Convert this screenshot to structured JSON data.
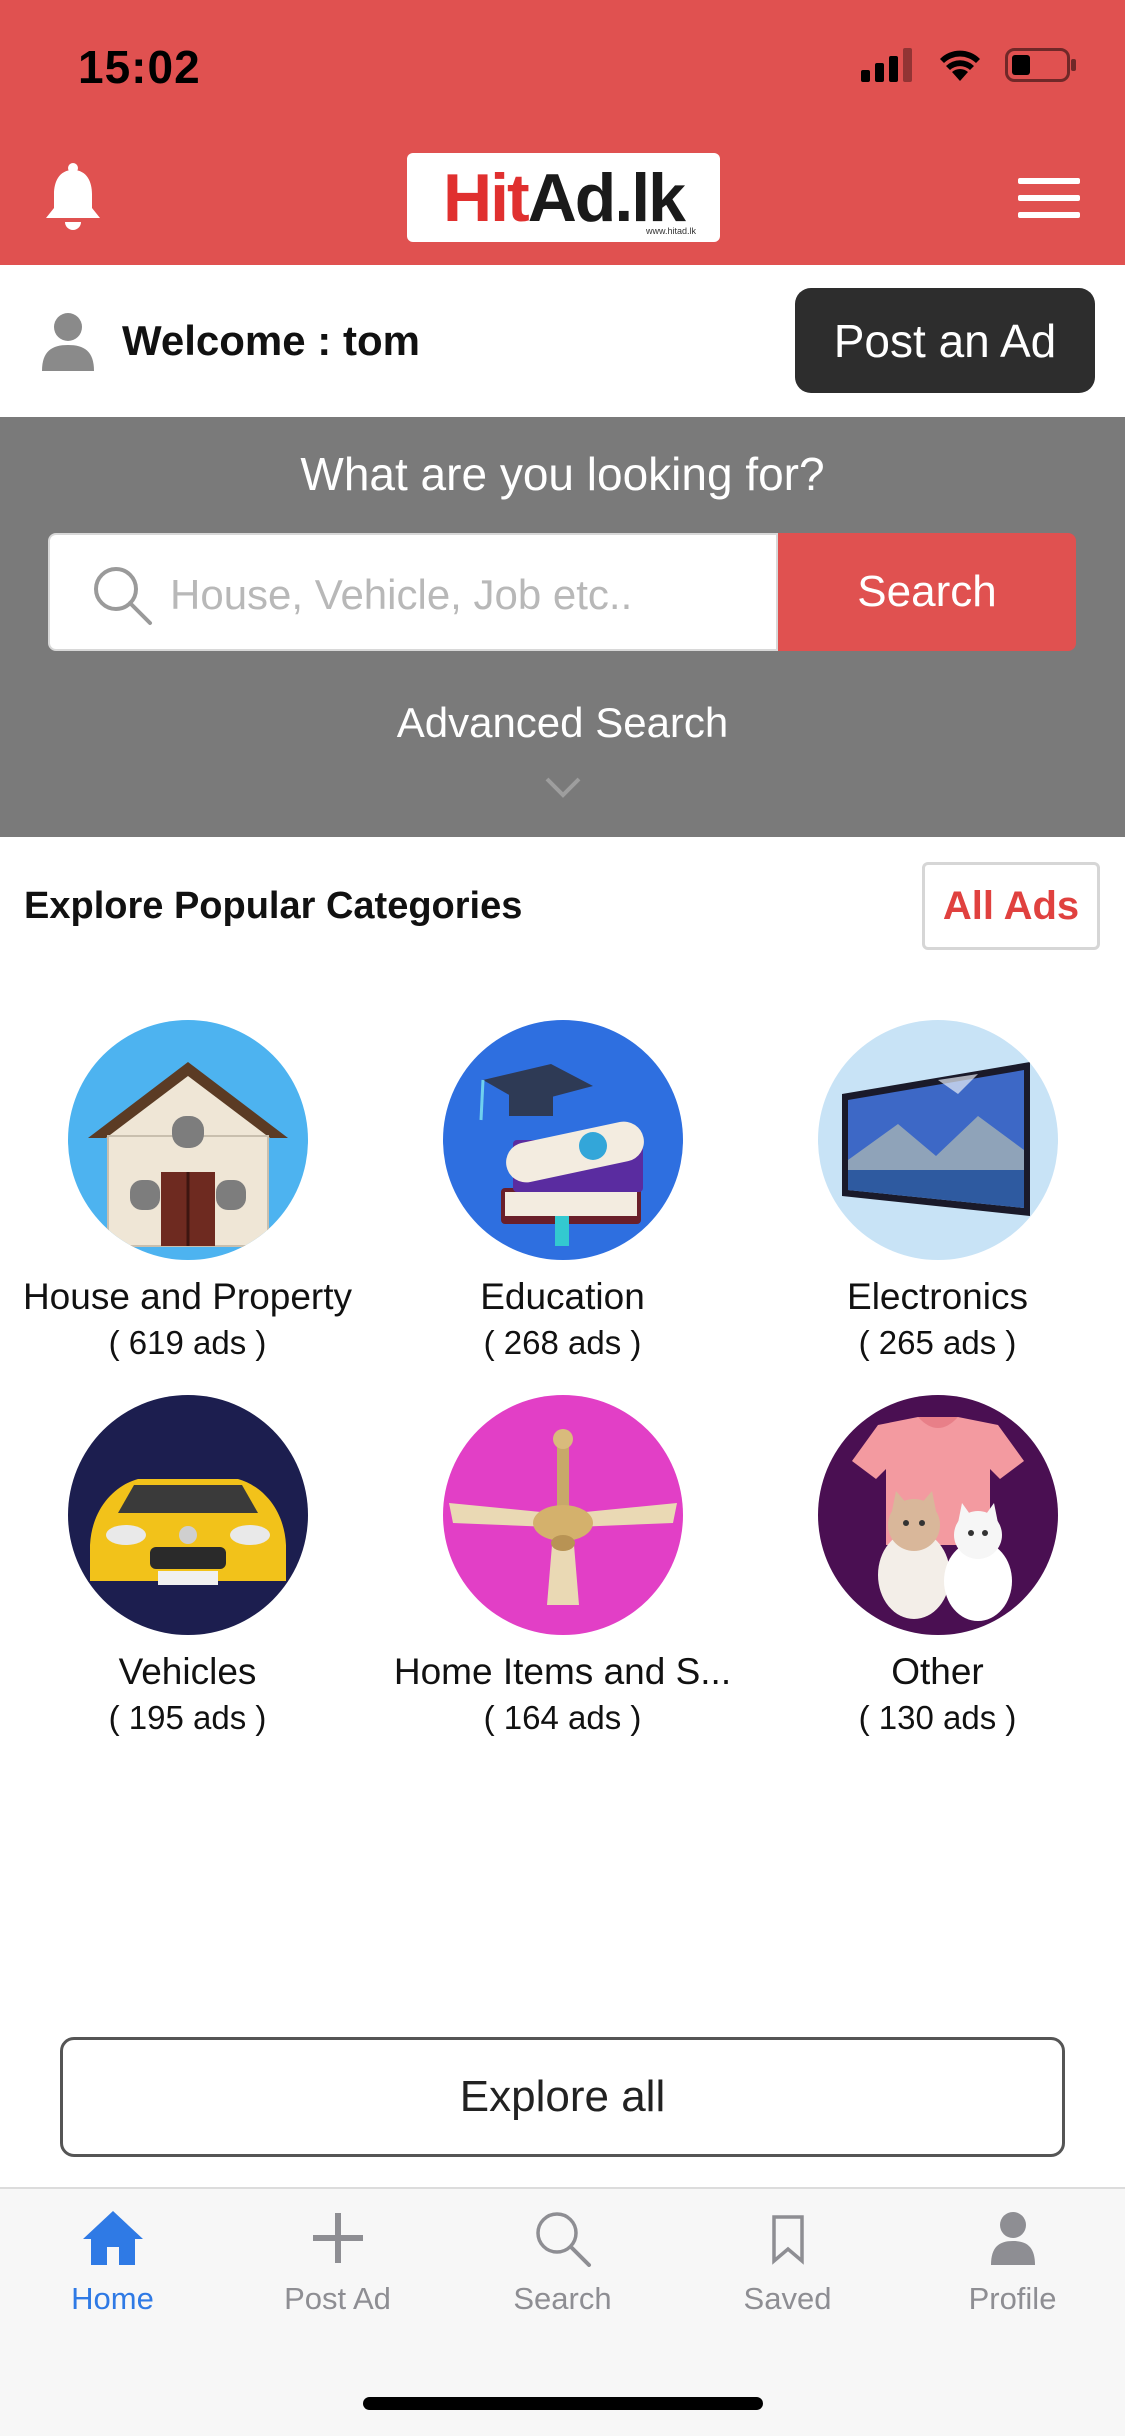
{
  "status_bar": {
    "time": "15:02",
    "icons": [
      "signal-icon",
      "wifi-icon",
      "battery-icon"
    ]
  },
  "header": {
    "logo_hit": "Hit",
    "logo_rest": "Ad.lk",
    "logo_sub": "www.hitad.lk",
    "colors": {
      "header_bg": "#e05150",
      "logo_red": "#e0302f"
    }
  },
  "welcome": {
    "text": "Welcome : tom",
    "post_ad_label": "Post an Ad"
  },
  "search": {
    "title": "What are you looking for?",
    "placeholder": "House, Vehicle, Job etc..",
    "button_label": "Search",
    "advanced_label": "Advanced Search"
  },
  "categories": {
    "heading": "Explore Popular Categories",
    "all_ads_label": "All Ads",
    "items": [
      {
        "name": "House and Property",
        "count": "( 619 ads )",
        "icon": "house-icon"
      },
      {
        "name": "Education",
        "count": "( 268 ads )",
        "icon": "graduation-books-icon"
      },
      {
        "name": "Electronics",
        "count": "( 265 ads )",
        "icon": "television-icon"
      },
      {
        "name": "Vehicles",
        "count": "( 195 ads )",
        "icon": "car-icon"
      },
      {
        "name": "Home Items and S...",
        "count": "( 164 ads )",
        "icon": "ceiling-fan-icon"
      },
      {
        "name": "Other",
        "count": "( 130 ads )",
        "icon": "cats-shirt-icon"
      }
    ]
  },
  "explore_all_label": "Explore all",
  "tabbar": {
    "items": [
      {
        "label": "Home",
        "icon": "home-icon",
        "active": true
      },
      {
        "label": "Post Ad",
        "icon": "plus-icon",
        "active": false
      },
      {
        "label": "Search",
        "icon": "search-icon",
        "active": false
      },
      {
        "label": "Saved",
        "icon": "bookmark-icon",
        "active": false
      },
      {
        "label": "Profile",
        "icon": "profile-icon",
        "active": false
      }
    ],
    "active_color": "#2f7ae5",
    "inactive_color": "#8e8e93"
  }
}
